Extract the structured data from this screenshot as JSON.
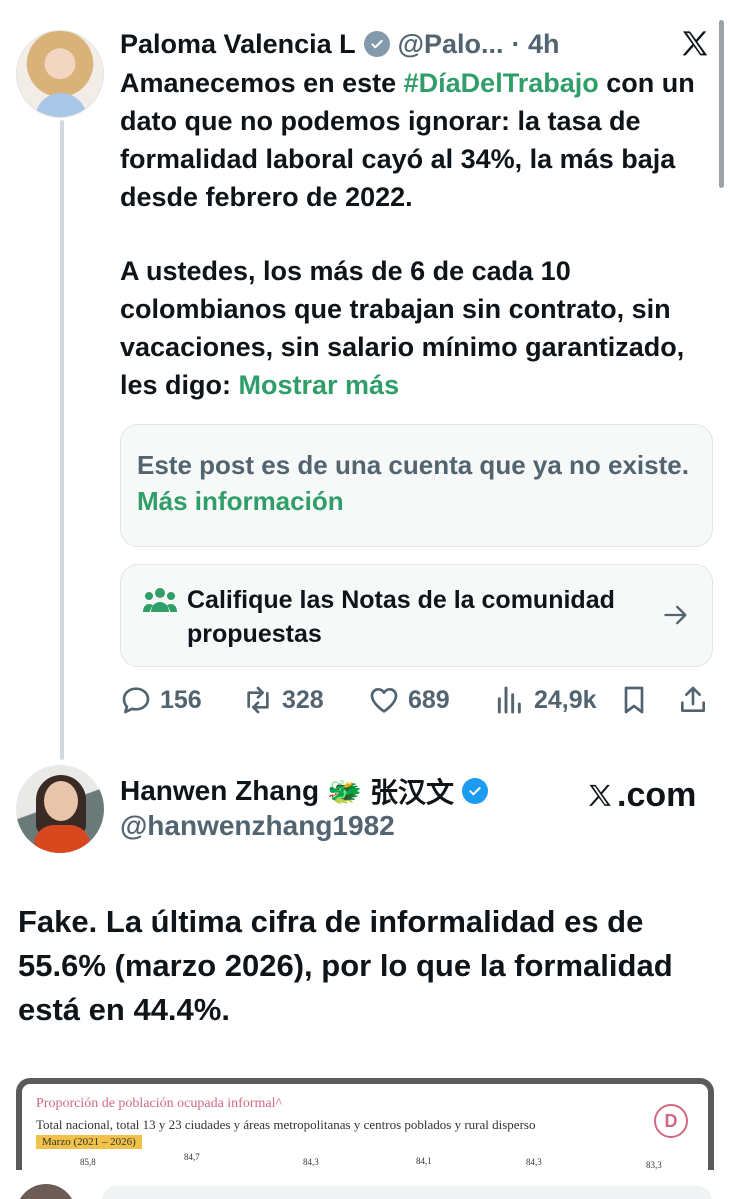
{
  "post1": {
    "author_name": "Paloma Valencia L",
    "handle": "@Palo...",
    "time": "· 4h",
    "text_segments": {
      "line1_start": "Amanecemos en este ",
      "hashtag": "#DíaDelTrabajo",
      "line1_rest": " con un dato que no podemos ignorar: la tasa de formalidad laboral cayó al 34%, la más baja desde febrero de 2022.",
      "para2": "A ustedes, los más de 6 de cada 10 colombianos que trabajan sin contrato, sin vacaciones, sin salario mínimo garantizado, les digo: ",
      "show_more": "Mostrar más"
    },
    "notice": {
      "text": "Este post es de una cuenta que ya no existe. ",
      "link": "Más información"
    },
    "community_notes": {
      "label": "Califique las Notas de la comunidad propuestas",
      "icon": "people-icon"
    },
    "actions": {
      "replies": "156",
      "reposts": "328",
      "likes": "689",
      "views": "24,9k"
    }
  },
  "post2": {
    "author_name": "Hanwen Zhang",
    "emoji": "🐲",
    "cjk_name": "张汉文",
    "handle": "@hanwenzhang1982",
    "watermark": ".com",
    "text": "Fake. La última cifra de informalidad es de 55.6% (marzo 2026), por lo que la formalidad está en 44.4%."
  },
  "chart_snippet": {
    "title": "Proporción de población ocupada informal^",
    "subtitle": "Total nacional, total 13 y 23 ciudades y áreas metropolitanas y centros poblados y rural disperso",
    "period_tag": "Marzo (2021 – 2026)",
    "logo_letter": "D",
    "values": [
      "85,8",
      "84,7",
      "84,3",
      "84,1",
      "84,3",
      "83,3"
    ]
  },
  "colors": {
    "accent_green": "#2f9e69",
    "verified_blue": "#1d9bf0",
    "muted_text": "#536471"
  }
}
